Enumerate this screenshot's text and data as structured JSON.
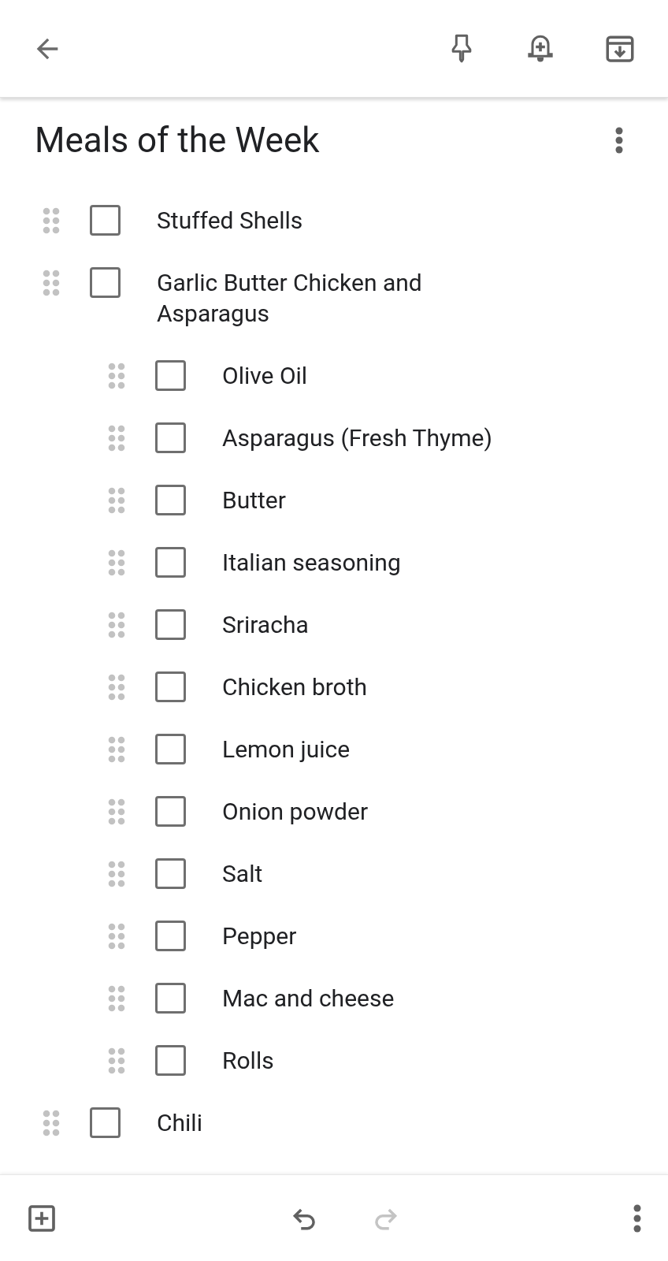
{
  "note": {
    "title": "Meals of the Week"
  },
  "items": [
    {
      "label": "Stuffed Shells",
      "checked": false
    },
    {
      "label": "Garlic Butter Chicken and Asparagus",
      "checked": false,
      "children": [
        {
          "label": "Olive Oil",
          "checked": false
        },
        {
          "label": "Asparagus (Fresh Thyme)",
          "checked": false
        },
        {
          "label": "Butter",
          "checked": false
        },
        {
          "label": "Italian seasoning",
          "checked": false
        },
        {
          "label": "Sriracha",
          "checked": false
        },
        {
          "label": "Chicken broth",
          "checked": false
        },
        {
          "label": "Lemon juice",
          "checked": false
        },
        {
          "label": "Onion powder",
          "checked": false
        },
        {
          "label": "Salt",
          "checked": false
        },
        {
          "label": "Pepper",
          "checked": false
        },
        {
          "label": "Mac and cheese",
          "checked": false
        },
        {
          "label": "Rolls",
          "checked": false
        }
      ]
    },
    {
      "label": "Chili",
      "checked": false
    }
  ],
  "bottom_bar": {
    "redo_disabled": true
  }
}
